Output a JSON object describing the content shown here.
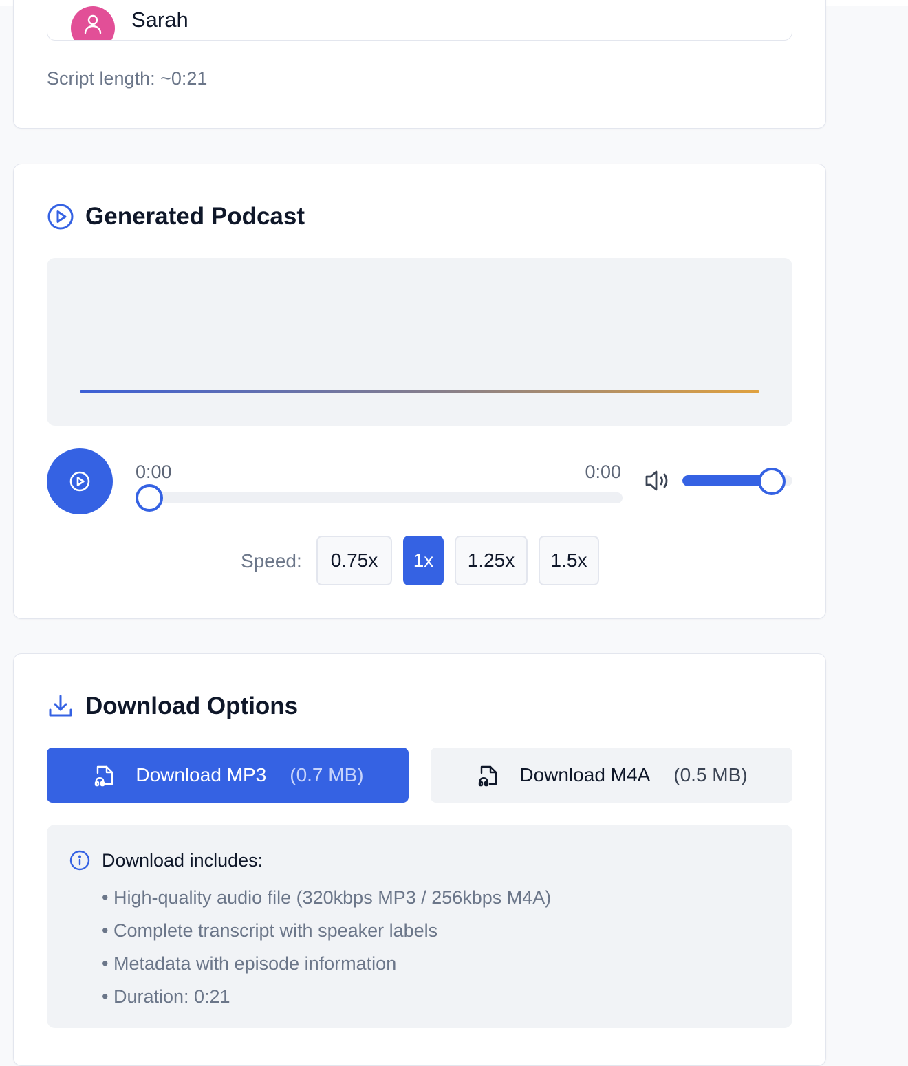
{
  "speakers_card": {
    "speaker_name": "Sarah",
    "script_length": "Script length: ~0:21"
  },
  "player": {
    "title": "Generated Podcast",
    "current_time": "0:00",
    "total_time": "0:00",
    "progress": 0,
    "volume": 0.75,
    "speed_label": "Speed:",
    "speeds": [
      "0.75x",
      "1x",
      "1.25x",
      "1.5x"
    ],
    "selected_speed": "1x"
  },
  "download": {
    "title": "Download Options",
    "mp3": {
      "label": "Download MP3",
      "size": "(0.7 MB)"
    },
    "m4a": {
      "label": "Download M4A",
      "size": "(0.5 MB)"
    },
    "includes_title": "Download includes:",
    "includes": [
      "High-quality audio file (320kbps MP3 / 256kbps M4A)",
      "Complete transcript with speaker labels",
      "Metadata with episode information",
      "Duration: 0:21"
    ]
  },
  "colors": {
    "accent": "#3562e3",
    "avatar": "#e24f97",
    "wave_start": "#3c5fd6",
    "wave_end": "#e0a13f"
  },
  "icons": {
    "avatar": "user-icon",
    "player_header": "play-circle-icon",
    "play_button": "play-icon",
    "volume": "volume-icon",
    "download_header": "download-icon",
    "file_audio": "file-audio-icon",
    "info": "info-icon"
  }
}
